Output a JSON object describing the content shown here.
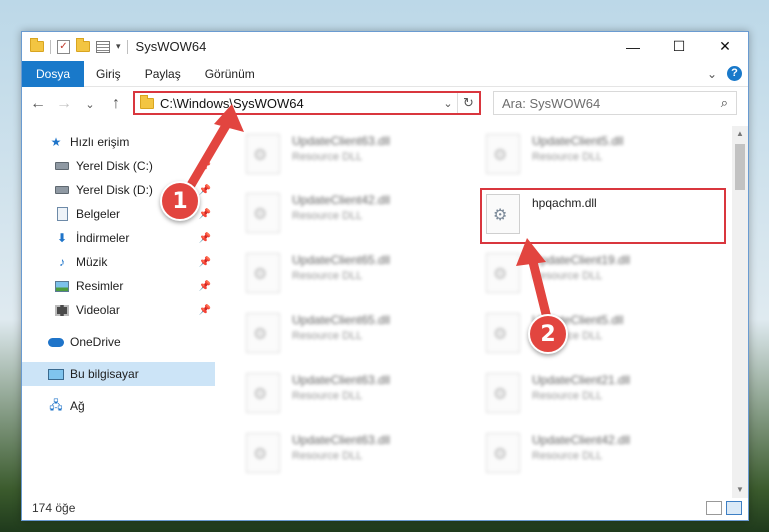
{
  "titlebar": {
    "title": "SysWOW64",
    "minimize": "—",
    "maximize": "☐",
    "close": "✕"
  },
  "ribbon": {
    "tabs": [
      "Dosya",
      "Giriş",
      "Paylaş",
      "Görünüm"
    ],
    "expand": "⌄",
    "help": "?"
  },
  "nav": {
    "back": "←",
    "forward": "→",
    "recent": "⌄",
    "up": "↑",
    "address": "C:\\Windows\\SysWOW64",
    "dropdown": "⌄",
    "refresh": "↻",
    "search_placeholder": "Ara: SysWOW64",
    "search_icon": "⌕"
  },
  "sidebar": {
    "items": [
      {
        "label": "Hızlı erişim",
        "icon": "star-icon"
      },
      {
        "label": "Yerel Disk (C:)",
        "icon": "disk-icon",
        "pinned": true
      },
      {
        "label": "Yerel Disk (D:)",
        "icon": "disk-icon",
        "pinned": true
      },
      {
        "label": "Belgeler",
        "icon": "documents-icon",
        "pinned": true
      },
      {
        "label": "İndirmeler",
        "icon": "download-icon",
        "pinned": true
      },
      {
        "label": "Müzik",
        "icon": "music-icon",
        "pinned": true
      },
      {
        "label": "Resimler",
        "icon": "pictures-icon",
        "pinned": true
      },
      {
        "label": "Videolar",
        "icon": "videos-icon",
        "pinned": true
      },
      {
        "label": "OneDrive",
        "icon": "cloud-icon"
      },
      {
        "label": "Bu bilgisayar",
        "icon": "computer-icon",
        "selected": true
      },
      {
        "label": "Ağ",
        "icon": "network-icon"
      }
    ]
  },
  "files": [
    {
      "name": "UpdateClient63.dll",
      "type": "Resource DLL"
    },
    {
      "name": "UpdateClient5.dll",
      "type": "Resource DLL"
    },
    {
      "name": "UpdateClient42.dll",
      "type": "Resource DLL"
    },
    {
      "name": "hpqachm.dll",
      "type": ""
    },
    {
      "name": "UpdateClient65.dll",
      "type": "Resource DLL"
    },
    {
      "name": "UpdateClient19.dll",
      "type": "Resource DLL"
    },
    {
      "name": "UpdateClient65.dll",
      "type": "Resource DLL"
    },
    {
      "name": "UpdateClient5.dll",
      "type": "Resource DLL"
    },
    {
      "name": "UpdateClient63.dll",
      "type": "Resource DLL"
    },
    {
      "name": "UpdateClient21.dll",
      "type": "Resource DLL"
    },
    {
      "name": "UpdateClient63.dll",
      "type": "Resource DLL"
    },
    {
      "name": "UpdateClient42.dll",
      "type": "Resource DLL"
    }
  ],
  "status": {
    "count": "174 öğe"
  },
  "annotations": {
    "step1": "1",
    "step2": "2"
  },
  "colors": {
    "accent": "#1979ca",
    "highlight": "#d9363e"
  }
}
